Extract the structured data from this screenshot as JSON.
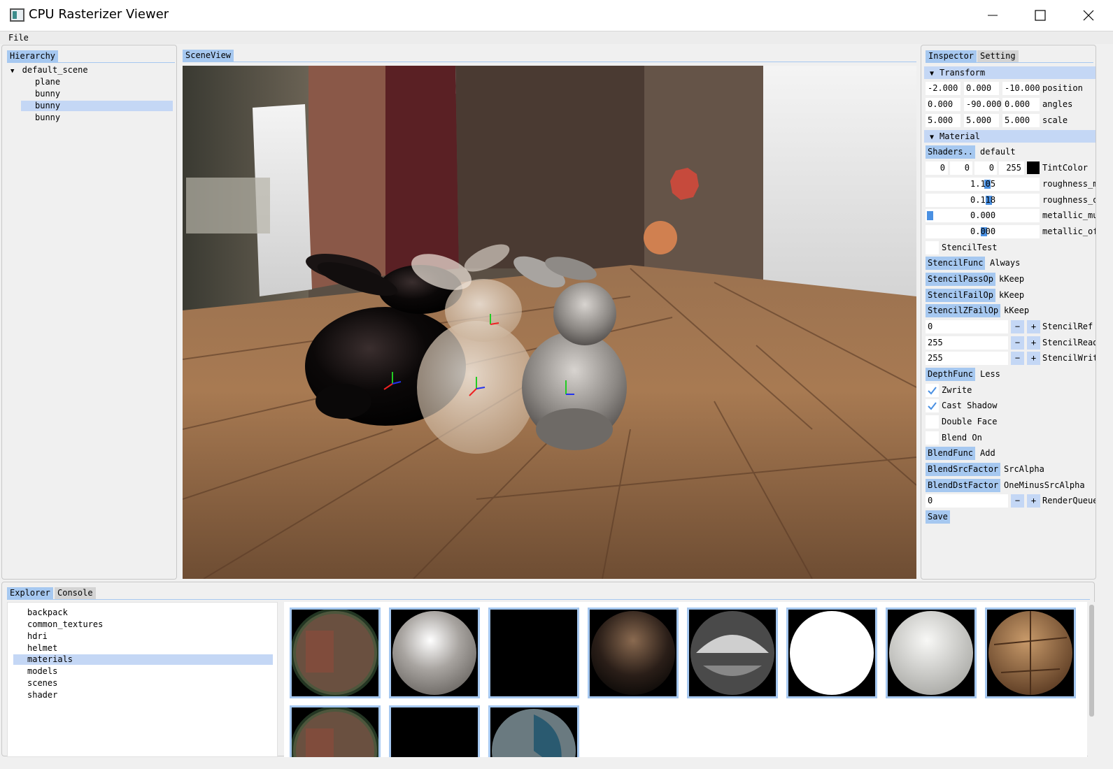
{
  "window": {
    "title": "CPU Rasterizer Viewer"
  },
  "menu": {
    "file": "File"
  },
  "hierarchy": {
    "tab": "Hierarchy",
    "root": "default_scene",
    "items": [
      "plane",
      "bunny",
      "bunny",
      "bunny"
    ],
    "selected_index": 2
  },
  "sceneview": {
    "tab": "SceneView"
  },
  "inspector": {
    "tabs": [
      "Inspector",
      "Setting"
    ],
    "transform": {
      "header": "Transform",
      "rows": [
        {
          "values": [
            "-2.000",
            "0.000",
            "-10.000"
          ],
          "label": "position"
        },
        {
          "values": [
            "0.000",
            "-90.000",
            "0.000"
          ],
          "label": "angles"
        },
        {
          "values": [
            "5.000",
            "5.000",
            "5.000"
          ],
          "label": "scale"
        }
      ]
    },
    "material": {
      "header": "Material",
      "shader_button": "Shaders..",
      "shader_name": "default",
      "tint": {
        "values": [
          "0",
          "0",
          "0",
          "255"
        ],
        "label": "TintColor",
        "swatch": "#000000"
      },
      "sliders": [
        {
          "value": "1.105",
          "label": "roughness_m",
          "fill": 0.78
        },
        {
          "value": "0.118",
          "label": "roughness_o",
          "fill": 0.78
        },
        {
          "value": "0.000",
          "label": "metallic_mu",
          "fill": 0.0
        },
        {
          "value": "0.000",
          "label": "metallic_of",
          "fill": 0.73
        }
      ],
      "stencil_test": "StencilTest",
      "stencil": [
        {
          "button": "StencilFunc",
          "value": "Always"
        },
        {
          "button": "StencilPassOp",
          "value": "kKeep"
        },
        {
          "button": "StencilFailOp",
          "value": "kKeep"
        },
        {
          "button": "StencilZFailOp",
          "value": "kKeep"
        }
      ],
      "spinners": [
        {
          "value": "0",
          "label": "StencilRef"
        },
        {
          "value": "255",
          "label": "StencilRead"
        },
        {
          "value": "255",
          "label": "StencilWrit"
        }
      ],
      "minus": "−",
      "plus": "+",
      "depth": {
        "button": "DepthFunc",
        "value": "Less"
      },
      "checks": [
        {
          "label": "Zwrite",
          "checked": true
        },
        {
          "label": "Cast Shadow",
          "checked": true
        },
        {
          "label": "Double Face",
          "checked": false
        },
        {
          "label": "Blend On",
          "checked": false
        }
      ],
      "blend": [
        {
          "button": "BlendFunc",
          "value": "Add"
        },
        {
          "button": "BlendSrcFactor",
          "value": "SrcAlpha"
        },
        {
          "button": "BlendDstFactor",
          "value": "OneMinusSrcAlpha"
        }
      ],
      "render_queue": {
        "value": "0",
        "label": "RenderQueue"
      },
      "save": "Save"
    }
  },
  "explorer": {
    "tabs": [
      "Explorer",
      "Console"
    ],
    "dirs": [
      "backpack",
      "common_textures",
      "hdri",
      "helmet",
      "materials",
      "models",
      "scenes",
      "shader"
    ],
    "selected_index": 4
  },
  "colors": {
    "accent": "#a6c8f0",
    "selection": "#c4d7f5",
    "slider": "#4a90e2"
  },
  "icons": [
    "app-icon",
    "minimize-icon",
    "maximize-icon",
    "close-icon",
    "triangle-down-icon",
    "check-icon"
  ]
}
